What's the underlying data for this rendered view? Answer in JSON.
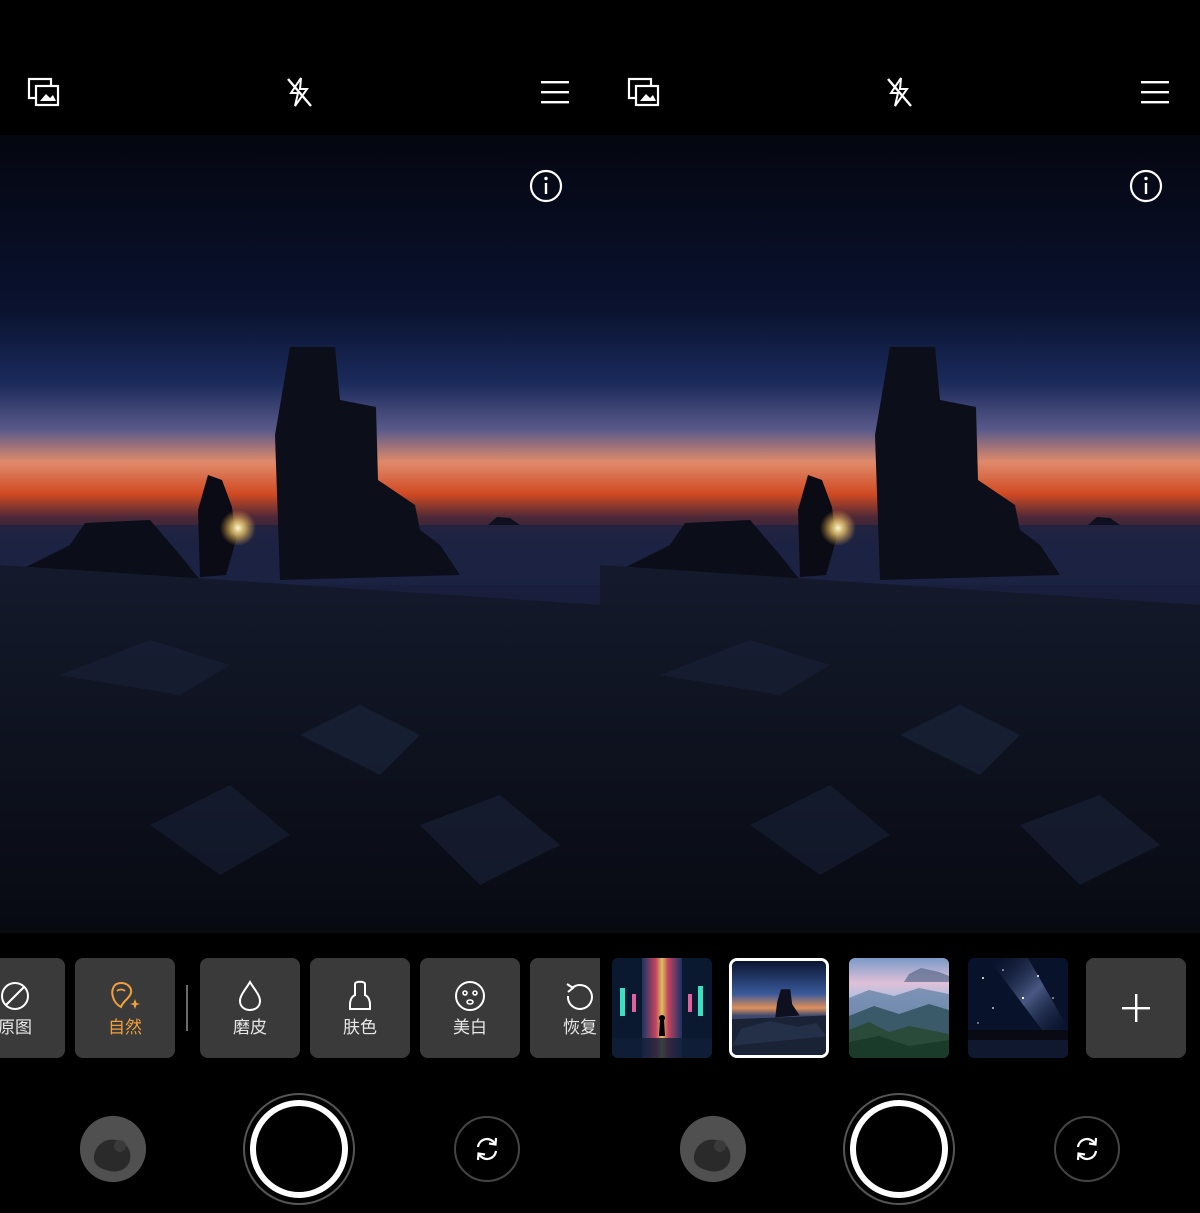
{
  "panels": [
    {
      "id": "beauty",
      "beauty_options": [
        {
          "label": "原图",
          "icon": "no-effect-icon",
          "active": false
        },
        {
          "label": "自然",
          "icon": "natural-beauty-icon",
          "active": true
        },
        {
          "label": "磨皮",
          "icon": "droplet-icon",
          "active": false
        },
        {
          "label": "肤色",
          "icon": "skin-tone-icon",
          "active": false
        },
        {
          "label": "美白",
          "icon": "face-icon",
          "active": false
        },
        {
          "label": "恢复",
          "icon": "reset-icon",
          "active": false
        }
      ]
    },
    {
      "id": "background",
      "backgrounds": [
        {
          "name": "neon-corridor",
          "selected": false
        },
        {
          "name": "sunset-rocks",
          "selected": true
        },
        {
          "name": "misty-mountains",
          "selected": false
        },
        {
          "name": "starry-night",
          "selected": false
        }
      ]
    }
  ],
  "icons": {
    "top_left": "gallery-overlay-icon",
    "top_center": "flash-off-icon",
    "top_right": "menu-icon",
    "info": "info-icon",
    "add": "plus-icon",
    "switch": "switch-camera-icon"
  },
  "colors": {
    "accent": "#f0a03c",
    "tile_bg": "#3a3a3a",
    "background": "#000000"
  }
}
